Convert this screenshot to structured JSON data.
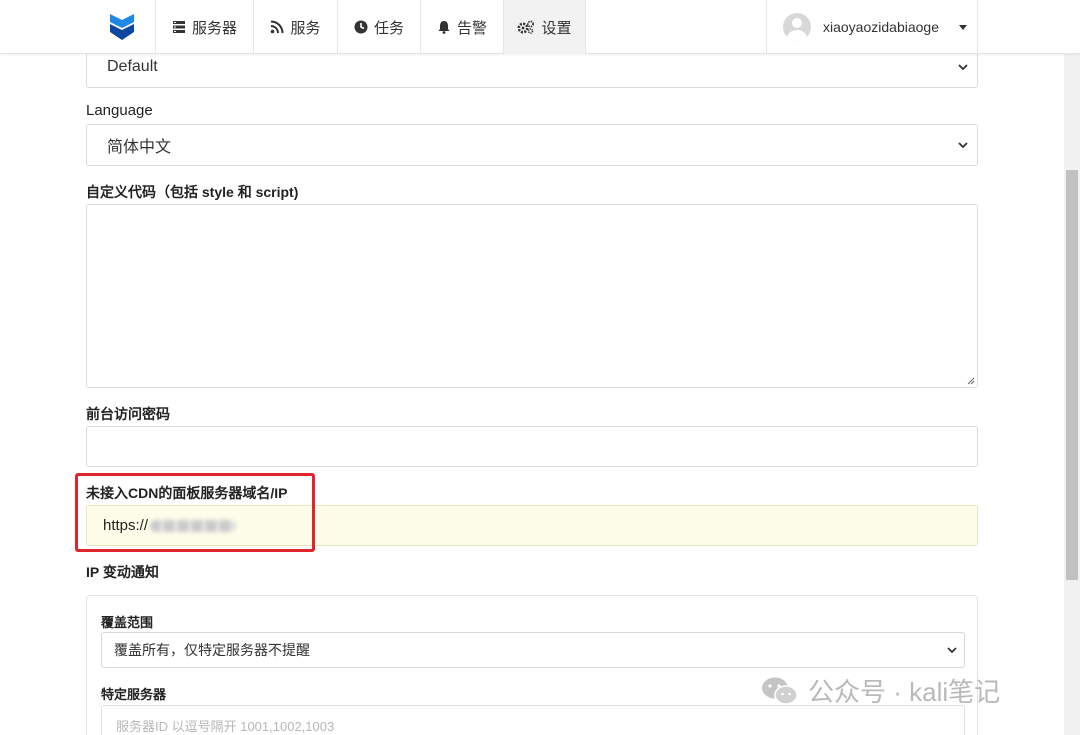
{
  "nav": {
    "items": [
      {
        "label": "服务器",
        "icon": "server-icon"
      },
      {
        "label": "服务",
        "icon": "rss-icon"
      },
      {
        "label": "任务",
        "icon": "clock-icon"
      },
      {
        "label": "告警",
        "icon": "bell-icon"
      },
      {
        "label": "设置",
        "icon": "gears-icon"
      }
    ],
    "active": "设置",
    "user": {
      "name": "xiaoyaozidabiaoge"
    }
  },
  "form": {
    "theme_value": "Default",
    "language_label": "Language",
    "language_value": "简体中文",
    "custom_code_label": "自定义代码（包括 style 和 script)",
    "custom_code_value": "",
    "site_password_label": "前台访问密码",
    "site_password_value": "",
    "panel_domain_label": "未接入CDN的面板服务器域名/IP",
    "panel_domain_value": "https://",
    "ip_change_label": "IP 变动通知",
    "ip_change": {
      "coverage_label": "覆盖范围",
      "coverage_value": "覆盖所有，仅特定服务器不提醒",
      "servers_label": "特定服务器",
      "servers_placeholder": "服务器ID 以逗号隔开 1001,1002,1003"
    }
  },
  "watermark": "公众号 · kali笔记",
  "colors": {
    "logo": "#1565d8",
    "highlight": "#e0262c",
    "warn_bg": "#fdfde9"
  }
}
